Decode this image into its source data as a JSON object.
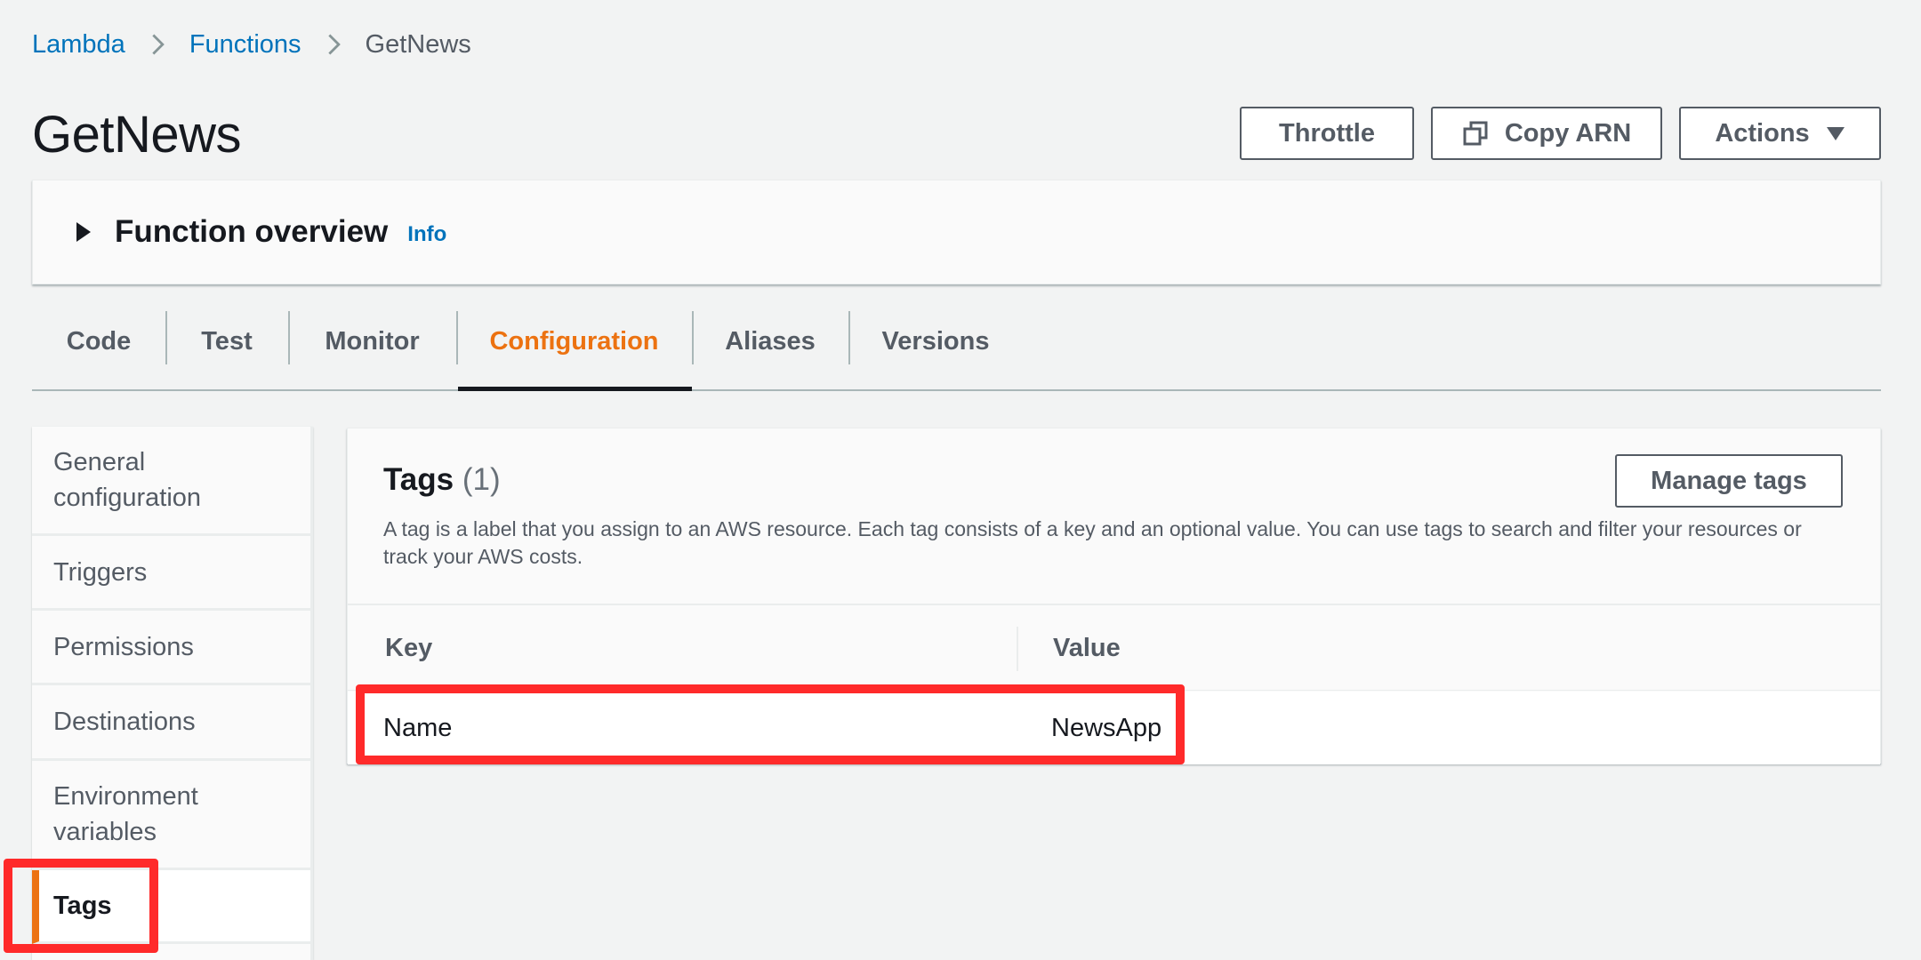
{
  "breadcrumb": {
    "items": [
      "Lambda",
      "Functions"
    ],
    "current": "GetNews"
  },
  "page": {
    "title": "GetNews"
  },
  "header_buttons": {
    "throttle": "Throttle",
    "copy_arn": "Copy ARN",
    "actions": "Actions"
  },
  "overview": {
    "title": "Function overview",
    "info": "Info"
  },
  "tabs": [
    {
      "label": "Code",
      "active": false
    },
    {
      "label": "Test",
      "active": false
    },
    {
      "label": "Monitor",
      "active": false
    },
    {
      "label": "Configuration",
      "active": true
    },
    {
      "label": "Aliases",
      "active": false
    },
    {
      "label": "Versions",
      "active": false
    }
  ],
  "sidebar": {
    "items": [
      {
        "label": "General configuration"
      },
      {
        "label": "Triggers"
      },
      {
        "label": "Permissions"
      },
      {
        "label": "Destinations"
      },
      {
        "label": "Environment variables"
      },
      {
        "label": "Tags",
        "active": true
      }
    ]
  },
  "tags_panel": {
    "title": "Tags",
    "count": "(1)",
    "description": "A tag is a label that you assign to an AWS resource. Each tag consists of a key and an optional value. You can use tags to search and filter your resources or track your AWS costs.",
    "manage_button": "Manage tags",
    "columns": [
      "Key",
      "Value"
    ],
    "rows": [
      {
        "key": "Name",
        "value": "NewsApp"
      }
    ]
  },
  "colors": {
    "link": "#0073bb",
    "accent_orange": "#ec7211",
    "highlight_red": "#ff2a2a",
    "background": "#f2f3f3"
  },
  "icons": [
    "chevron-right-icon",
    "copy-icon",
    "caret-down-icon",
    "caret-right-icon"
  ]
}
